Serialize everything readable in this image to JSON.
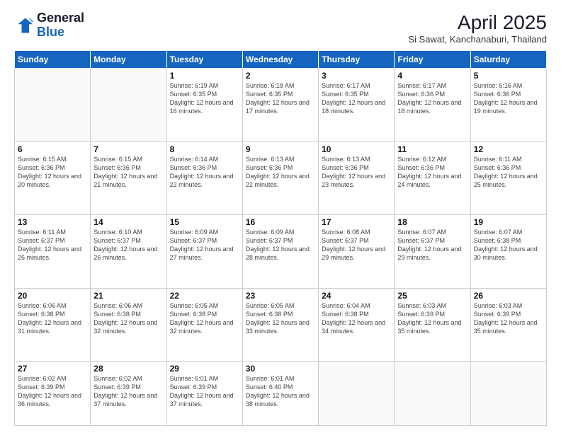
{
  "logo": {
    "general": "General",
    "blue": "Blue"
  },
  "header": {
    "month": "April 2025",
    "location": "Si Sawat, Kanchanaburi, Thailand"
  },
  "weekdays": [
    "Sunday",
    "Monday",
    "Tuesday",
    "Wednesday",
    "Thursday",
    "Friday",
    "Saturday"
  ],
  "weeks": [
    [
      {
        "day": "",
        "info": ""
      },
      {
        "day": "",
        "info": ""
      },
      {
        "day": "1",
        "info": "Sunrise: 6:19 AM\nSunset: 6:35 PM\nDaylight: 12 hours and 16 minutes."
      },
      {
        "day": "2",
        "info": "Sunrise: 6:18 AM\nSunset: 6:35 PM\nDaylight: 12 hours and 17 minutes."
      },
      {
        "day": "3",
        "info": "Sunrise: 6:17 AM\nSunset: 6:35 PM\nDaylight: 12 hours and 18 minutes."
      },
      {
        "day": "4",
        "info": "Sunrise: 6:17 AM\nSunset: 6:36 PM\nDaylight: 12 hours and 18 minutes."
      },
      {
        "day": "5",
        "info": "Sunrise: 6:16 AM\nSunset: 6:36 PM\nDaylight: 12 hours and 19 minutes."
      }
    ],
    [
      {
        "day": "6",
        "info": "Sunrise: 6:15 AM\nSunset: 6:36 PM\nDaylight: 12 hours and 20 minutes."
      },
      {
        "day": "7",
        "info": "Sunrise: 6:15 AM\nSunset: 6:36 PM\nDaylight: 12 hours and 21 minutes."
      },
      {
        "day": "8",
        "info": "Sunrise: 6:14 AM\nSunset: 6:36 PM\nDaylight: 12 hours and 22 minutes."
      },
      {
        "day": "9",
        "info": "Sunrise: 6:13 AM\nSunset: 6:36 PM\nDaylight: 12 hours and 22 minutes."
      },
      {
        "day": "10",
        "info": "Sunrise: 6:13 AM\nSunset: 6:36 PM\nDaylight: 12 hours and 23 minutes."
      },
      {
        "day": "11",
        "info": "Sunrise: 6:12 AM\nSunset: 6:36 PM\nDaylight: 12 hours and 24 minutes."
      },
      {
        "day": "12",
        "info": "Sunrise: 6:11 AM\nSunset: 6:36 PM\nDaylight: 12 hours and 25 minutes."
      }
    ],
    [
      {
        "day": "13",
        "info": "Sunrise: 6:11 AM\nSunset: 6:37 PM\nDaylight: 12 hours and 26 minutes."
      },
      {
        "day": "14",
        "info": "Sunrise: 6:10 AM\nSunset: 6:37 PM\nDaylight: 12 hours and 26 minutes."
      },
      {
        "day": "15",
        "info": "Sunrise: 6:09 AM\nSunset: 6:37 PM\nDaylight: 12 hours and 27 minutes."
      },
      {
        "day": "16",
        "info": "Sunrise: 6:09 AM\nSunset: 6:37 PM\nDaylight: 12 hours and 28 minutes."
      },
      {
        "day": "17",
        "info": "Sunrise: 6:08 AM\nSunset: 6:37 PM\nDaylight: 12 hours and 29 minutes."
      },
      {
        "day": "18",
        "info": "Sunrise: 6:07 AM\nSunset: 6:37 PM\nDaylight: 12 hours and 29 minutes."
      },
      {
        "day": "19",
        "info": "Sunrise: 6:07 AM\nSunset: 6:38 PM\nDaylight: 12 hours and 30 minutes."
      }
    ],
    [
      {
        "day": "20",
        "info": "Sunrise: 6:06 AM\nSunset: 6:38 PM\nDaylight: 12 hours and 31 minutes."
      },
      {
        "day": "21",
        "info": "Sunrise: 6:06 AM\nSunset: 6:38 PM\nDaylight: 12 hours and 32 minutes."
      },
      {
        "day": "22",
        "info": "Sunrise: 6:05 AM\nSunset: 6:38 PM\nDaylight: 12 hours and 32 minutes."
      },
      {
        "day": "23",
        "info": "Sunrise: 6:05 AM\nSunset: 6:38 PM\nDaylight: 12 hours and 33 minutes."
      },
      {
        "day": "24",
        "info": "Sunrise: 6:04 AM\nSunset: 6:38 PM\nDaylight: 12 hours and 34 minutes."
      },
      {
        "day": "25",
        "info": "Sunrise: 6:03 AM\nSunset: 6:39 PM\nDaylight: 12 hours and 35 minutes."
      },
      {
        "day": "26",
        "info": "Sunrise: 6:03 AM\nSunset: 6:39 PM\nDaylight: 12 hours and 35 minutes."
      }
    ],
    [
      {
        "day": "27",
        "info": "Sunrise: 6:02 AM\nSunset: 6:39 PM\nDaylight: 12 hours and 36 minutes."
      },
      {
        "day": "28",
        "info": "Sunrise: 6:02 AM\nSunset: 6:39 PM\nDaylight: 12 hours and 37 minutes."
      },
      {
        "day": "29",
        "info": "Sunrise: 6:01 AM\nSunset: 6:39 PM\nDaylight: 12 hours and 37 minutes."
      },
      {
        "day": "30",
        "info": "Sunrise: 6:01 AM\nSunset: 6:40 PM\nDaylight: 12 hours and 38 minutes."
      },
      {
        "day": "",
        "info": ""
      },
      {
        "day": "",
        "info": ""
      },
      {
        "day": "",
        "info": ""
      }
    ]
  ]
}
